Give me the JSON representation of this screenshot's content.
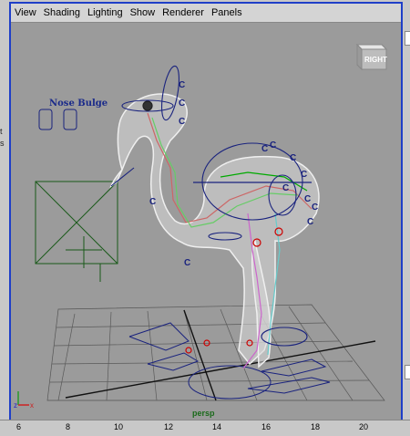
{
  "menu": [
    "View",
    "Shading",
    "Lighting",
    "Show",
    "Renderer",
    "Panels"
  ],
  "viewcube_label": "RIGHT",
  "nose_bulge_label": "Nose Bulge",
  "camera_label": "persp",
  "left_strip_chars": [
    "t",
    "s"
  ],
  "ruler_ticks": [
    "6",
    "8",
    "10",
    "12",
    "14",
    "16",
    "18",
    "20"
  ],
  "control_marker": "C",
  "colors": {
    "viewport_bg": "#9b9b9b",
    "active_border": "#1f3fc8",
    "control": "#1a237e",
    "grid": "#505050"
  }
}
